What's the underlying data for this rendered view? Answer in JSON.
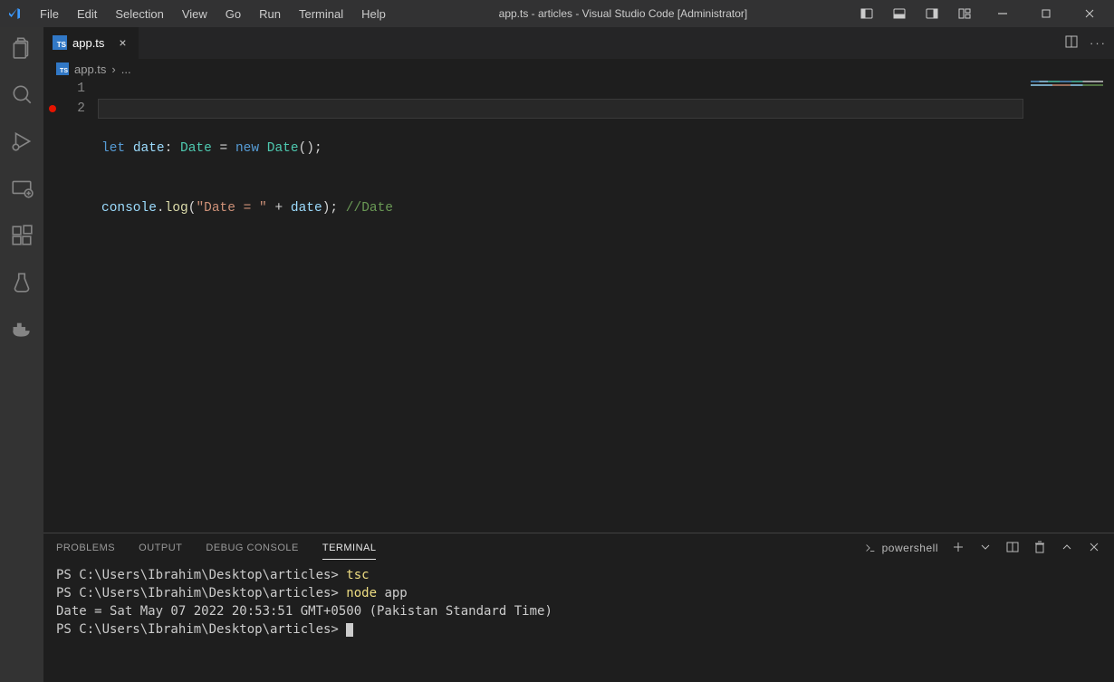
{
  "window": {
    "title": "app.ts - articles - Visual Studio Code [Administrator]"
  },
  "menu": {
    "items": [
      "File",
      "Edit",
      "Selection",
      "View",
      "Go",
      "Run",
      "Terminal",
      "Help"
    ]
  },
  "tab": {
    "filename": "app.ts"
  },
  "breadcrumb": {
    "filename": "app.ts",
    "sep": "›",
    "tail": "..."
  },
  "editor": {
    "gutter": [
      "1",
      "2"
    ],
    "line1": {
      "let": "let",
      "var": "date",
      "colon": ":",
      "type": "Date",
      "eq": " = ",
      "new": "new",
      "ctor": "Date",
      "paren": "();"
    },
    "line2": {
      "obj": "console",
      "dot": ".",
      "fn": "log",
      "open": "(",
      "str": "\"Date = \"",
      "plus": " + ",
      "arg": "date",
      "close": "); ",
      "comment": "//Date"
    }
  },
  "panel": {
    "tabs": {
      "problems": "PROBLEMS",
      "output": "OUTPUT",
      "debug": "DEBUG CONSOLE",
      "terminal": "TERMINAL"
    },
    "shell": "powershell"
  },
  "terminal": {
    "l1_prompt": "PS C:\\Users\\Ibrahim\\Desktop\\articles> ",
    "l1_cmd": "tsc",
    "l2_prompt": "PS C:\\Users\\Ibrahim\\Desktop\\articles> ",
    "l2_cmd1": "node",
    "l2_cmd2": " app",
    "l3_out": "Date = Sat May 07 2022 20:53:51 GMT+0500 (Pakistan Standard Time)",
    "l4_prompt": "PS C:\\Users\\Ibrahim\\Desktop\\articles> "
  }
}
